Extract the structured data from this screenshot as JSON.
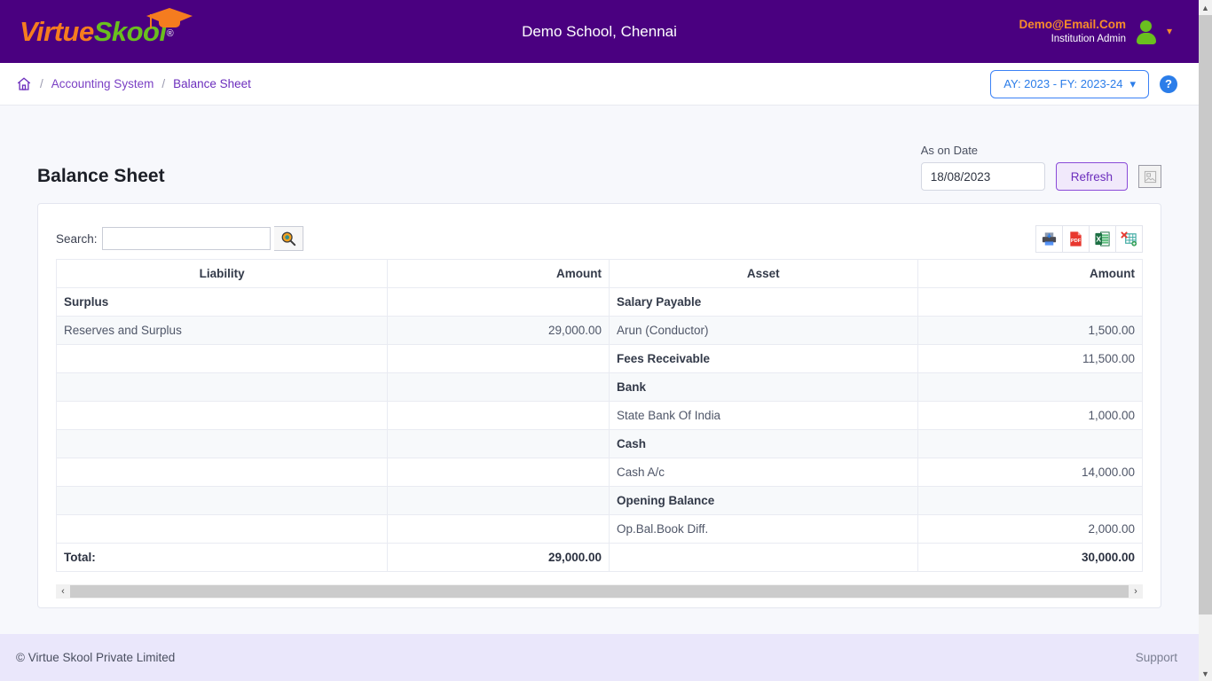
{
  "header": {
    "logo": {
      "part1": "Virtue",
      "part2": "Skool",
      "registered": "®",
      "cap_icon": "graduation-cap-icon"
    },
    "school_name": "Demo School, Chennai",
    "user_email": "Demo@Email.Com",
    "user_role": "Institution Admin",
    "avatar_icon": "user-avatar-icon",
    "caret_icon": "chevron-down-icon",
    "bg_color": "#4a0080",
    "email_color": "#f78c2a"
  },
  "breadcrumb": {
    "home_icon": "home-icon",
    "sep": "/",
    "items": [
      {
        "label": "Accounting System"
      },
      {
        "label": "Balance Sheet"
      }
    ],
    "year_selector": {
      "label": "AY: 2023 - FY: 2023-24",
      "caret": "chevron-down-icon"
    },
    "help_button": {
      "label": "?",
      "color": "#2b7de9"
    }
  },
  "page": {
    "title": "Balance Sheet",
    "as_on_date_label": "As on Date",
    "as_on_date_value": "18/08/2023",
    "as_on_date_placeholder": "dd/mm/yyyy",
    "refresh_label": "Refresh",
    "image_button_icon": "image-placeholder-icon"
  },
  "toolbar": {
    "search_label": "Search:",
    "search_value": "",
    "search_placeholder": "",
    "search_icon": "search-magnifier-icon",
    "exports": [
      {
        "name": "print-icon",
        "label": "Print"
      },
      {
        "name": "pdf-icon",
        "label": "PDF"
      },
      {
        "name": "excel-icon",
        "label": "Excel"
      },
      {
        "name": "csv-icon",
        "label": "CSV"
      }
    ]
  },
  "table": {
    "columns": [
      "Liability",
      "Amount",
      "Asset",
      "Amount"
    ],
    "rows": [
      {
        "liability": "Surplus",
        "liability_bold": true,
        "lamount": "",
        "asset": "Salary Payable",
        "asset_bold": true,
        "aamount": ""
      },
      {
        "liability": "Reserves and Surplus",
        "liability_bold": false,
        "lamount": "29,000.00",
        "asset": "Arun (Conductor)",
        "asset_bold": false,
        "aamount": "1,500.00"
      },
      {
        "liability": "",
        "liability_bold": false,
        "lamount": "",
        "asset": "Fees Receivable",
        "asset_bold": true,
        "aamount": "11,500.00"
      },
      {
        "liability": "",
        "liability_bold": false,
        "lamount": "",
        "asset": "Bank",
        "asset_bold": true,
        "aamount": ""
      },
      {
        "liability": "",
        "liability_bold": false,
        "lamount": "",
        "asset": "State Bank Of India",
        "asset_bold": false,
        "aamount": "1,000.00"
      },
      {
        "liability": "",
        "liability_bold": false,
        "lamount": "",
        "asset": "Cash",
        "asset_bold": true,
        "aamount": ""
      },
      {
        "liability": "",
        "liability_bold": false,
        "lamount": "",
        "asset": "Cash A/c",
        "asset_bold": false,
        "aamount": "14,000.00"
      },
      {
        "liability": "",
        "liability_bold": false,
        "lamount": "",
        "asset": "Opening Balance",
        "asset_bold": true,
        "aamount": ""
      },
      {
        "liability": "",
        "liability_bold": false,
        "lamount": "",
        "asset": "Op.Bal.Book Diff.",
        "asset_bold": false,
        "aamount": "2,000.00"
      }
    ],
    "total": {
      "label": "Total:",
      "liability_total": "29,000.00",
      "asset_label": "",
      "asset_total": "30,000.00"
    }
  },
  "scrollbar": {
    "left_arrow": "‹",
    "right_arrow": "›"
  },
  "footer": {
    "copyright": "© Virtue Skool Private Limited",
    "support": "Support"
  },
  "browser_scroll": {
    "up_arrow": "⌃",
    "down_arrow": "⌄"
  }
}
